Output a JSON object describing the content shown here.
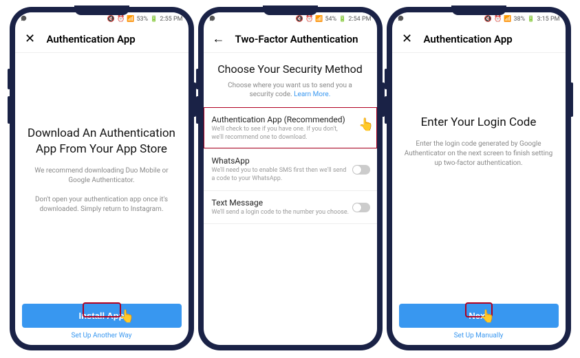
{
  "phones": [
    {
      "status": {
        "battery": "53%",
        "time": "2:55 PM"
      },
      "nav": {
        "icon": "✕",
        "title": "Authentication App"
      },
      "heading": "Download An Authentication App From Your App Store",
      "p1": "We recommend downloading Duo Mobile or Google Authenticator.",
      "p2": "Don't open your authentication app once it's downloaded. Simply return to Instagram.",
      "primary": "Install App",
      "secondary": "Set Up Another Way"
    },
    {
      "status": {
        "battery": "54%",
        "time": "2:54 PM"
      },
      "nav": {
        "icon": "←",
        "title": "Two-Factor Authentication"
      },
      "heading": "Choose Your Security Method",
      "sub": "Choose where you want us to send you a security code.",
      "learn": "Learn More.",
      "options": [
        {
          "title": "Authentication App (Recommended)",
          "desc": "We'll check to see if you have one. If you don't, we'll recommend one to download."
        },
        {
          "title": "WhatsApp",
          "desc": "We'll need you to enable SMS first then we'll send a code to your WhatsApp."
        },
        {
          "title": "Text Message",
          "desc": "We'll send a login code to the number you choose."
        }
      ]
    },
    {
      "status": {
        "battery": "38%",
        "time": "3:15 PM"
      },
      "nav": {
        "icon": "✕",
        "title": "Authentication App"
      },
      "heading": "Enter Your Login Code",
      "p1": "Enter the login code generated by Google Authenticator on the next screen to finish setting up two-factor authentication.",
      "primary": "Next",
      "secondary": "Set Up Manually"
    }
  ]
}
